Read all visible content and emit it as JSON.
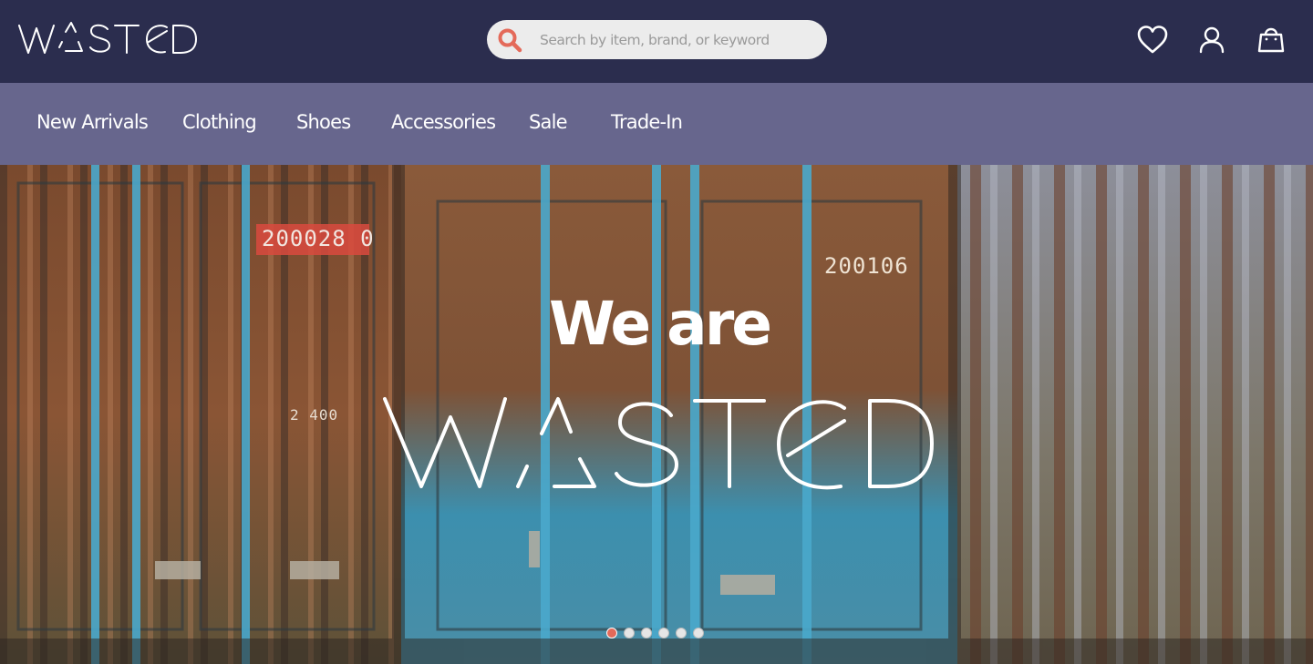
{
  "brand": {
    "logo_text": "WASTED",
    "colors": {
      "header": "#2b2d4e",
      "nav": "#67668d",
      "accent": "#e46a5a"
    }
  },
  "search": {
    "placeholder": "Search by item, brand, or keyword",
    "value": "",
    "icon": "search-icon"
  },
  "header_icons": [
    {
      "name": "heart-icon",
      "label": "Wishlist"
    },
    {
      "name": "user-icon",
      "label": "Account"
    },
    {
      "name": "bag-icon",
      "label": "Cart"
    }
  ],
  "nav": {
    "items": [
      {
        "label": "New Arrivals"
      },
      {
        "label": "Clothing"
      },
      {
        "label": "Shoes"
      },
      {
        "label": "Accessories"
      },
      {
        "label": "Sale"
      },
      {
        "label": "Trade-In"
      }
    ]
  },
  "hero": {
    "title": "We are",
    "logo_text": "WASTED",
    "stencil_texts": [
      "200028 0",
      "200106",
      "2 400"
    ],
    "slides": {
      "count": 6,
      "active": 1
    }
  }
}
